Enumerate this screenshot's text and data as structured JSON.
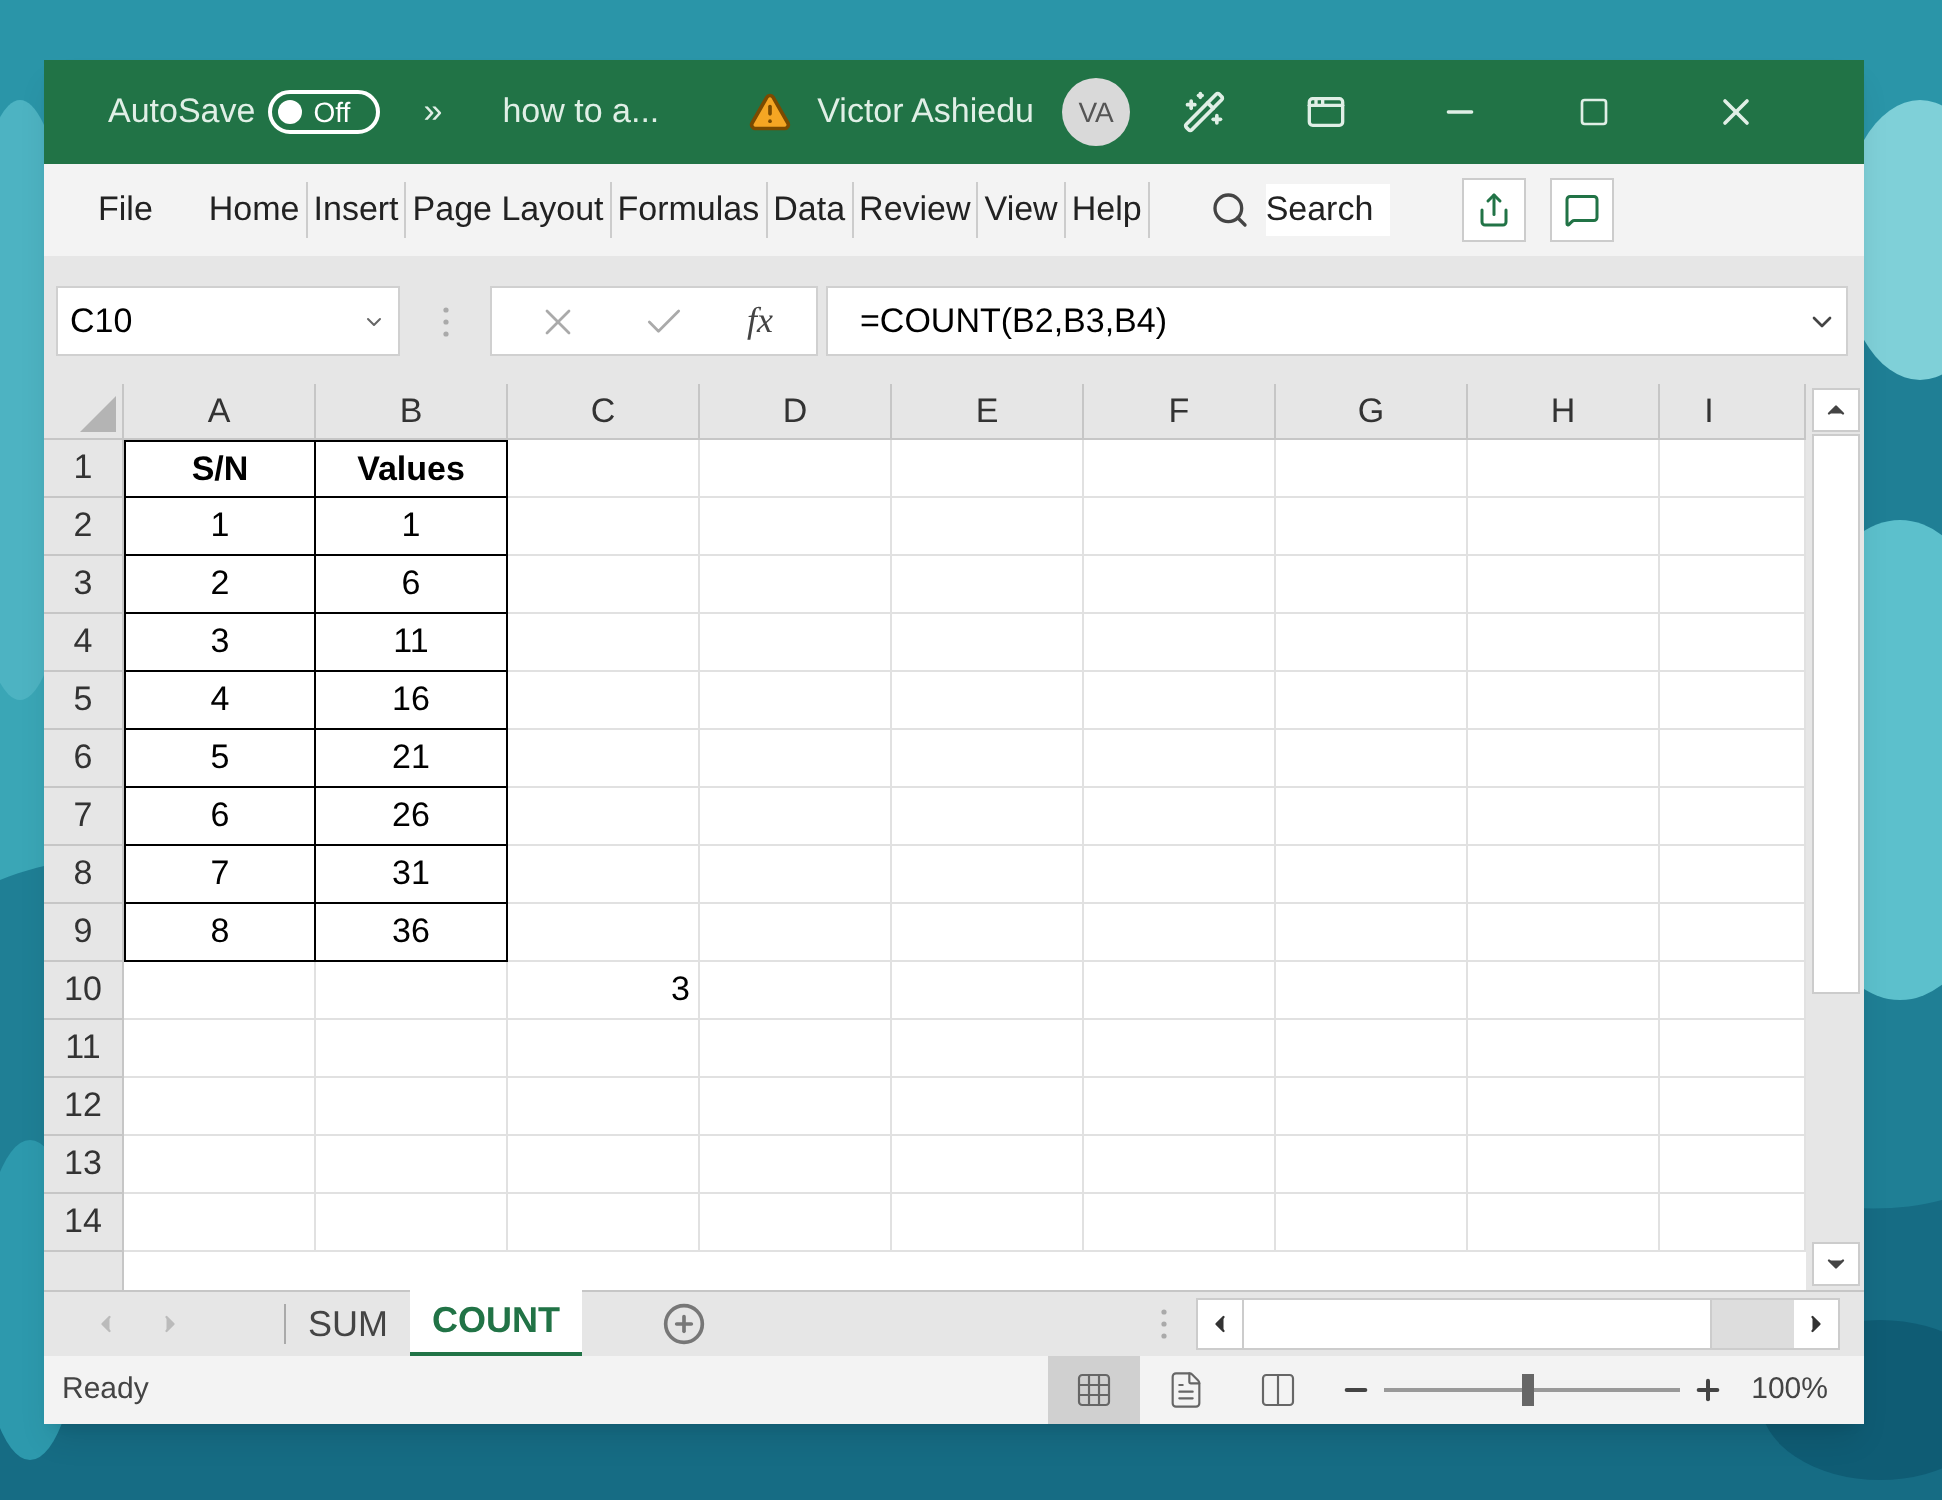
{
  "title_bar": {
    "autosave_label": "AutoSave",
    "autosave_toggle": {
      "label": "Off",
      "on": false
    },
    "more": "»",
    "document_title": "how to a...",
    "user_name": "Victor Ashiedu",
    "avatar": "VA"
  },
  "ribbon": {
    "tabs": [
      "File",
      "Home",
      "Insert",
      "Page Layout",
      "Formulas",
      "Data",
      "Review",
      "View",
      "Help"
    ],
    "search": {
      "placeholder": "Search"
    }
  },
  "formula_bar": {
    "name_box": "C10",
    "fx": "fx",
    "formula": "=COUNT(B2,B3,B4)"
  },
  "grid": {
    "columns": [
      "A",
      "B",
      "C",
      "D",
      "E",
      "F",
      "G",
      "H",
      "I"
    ],
    "rows": [
      {
        "header": "1",
        "cells": [
          {
            "kind": "heading",
            "text": "S/N"
          },
          {
            "kind": "heading",
            "text": "Values"
          }
        ]
      },
      {
        "header": "2",
        "cells": [
          {
            "kind": "boxed",
            "text": "1"
          },
          {
            "kind": "boxed",
            "text": "1"
          }
        ]
      },
      {
        "header": "3",
        "cells": [
          {
            "kind": "boxed",
            "text": "2"
          },
          {
            "kind": "boxed",
            "text": "6"
          }
        ]
      },
      {
        "header": "4",
        "cells": [
          {
            "kind": "boxed",
            "text": "3"
          },
          {
            "kind": "boxed",
            "text": "11"
          }
        ]
      },
      {
        "header": "5",
        "cells": [
          {
            "kind": "boxed",
            "text": "4"
          },
          {
            "kind": "boxed",
            "text": "16"
          }
        ]
      },
      {
        "header": "6",
        "cells": [
          {
            "kind": "boxed",
            "text": "5"
          },
          {
            "kind": "boxed",
            "text": "21"
          }
        ]
      },
      {
        "header": "7",
        "cells": [
          {
            "kind": "boxed",
            "text": "6"
          },
          {
            "kind": "boxed",
            "text": "26"
          }
        ]
      },
      {
        "header": "8",
        "cells": [
          {
            "kind": "boxed",
            "text": "7"
          },
          {
            "kind": "boxed",
            "text": "31"
          }
        ]
      },
      {
        "header": "9",
        "cells": [
          {
            "kind": "boxed",
            "text": "8"
          },
          {
            "kind": "boxed",
            "text": "36"
          }
        ]
      },
      {
        "header": "10",
        "cells": [
          {
            "kind": "empty"
          },
          {
            "kind": "empty"
          },
          {
            "kind": "number",
            "text": "3"
          }
        ]
      },
      {
        "header": "11"
      },
      {
        "header": "12"
      },
      {
        "header": "13"
      },
      {
        "header": "14"
      }
    ]
  },
  "sheet_tabs": [
    {
      "label": "SUM",
      "selected": false
    },
    {
      "label": "COUNT",
      "selected": true
    }
  ],
  "status_bar": {
    "status": "Ready",
    "views": [
      {
        "kind": "normal",
        "selected": true
      },
      {
        "kind": "page_layout",
        "selected": false
      },
      {
        "kind": "page_break",
        "selected": false
      }
    ],
    "zoom": {
      "level": 0.49,
      "reading": "100%"
    }
  }
}
